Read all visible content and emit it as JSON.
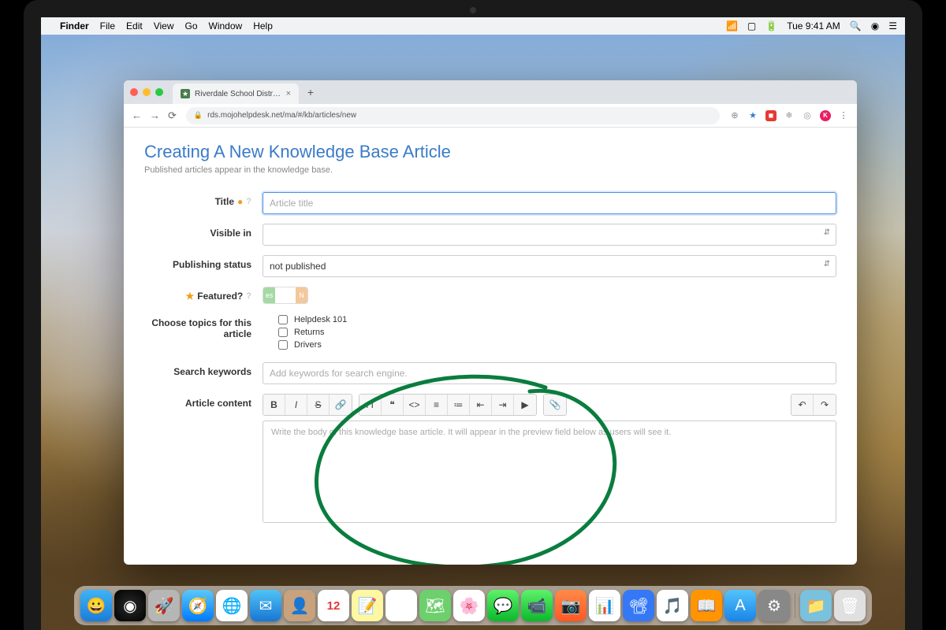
{
  "mac_menu": {
    "app_name": "Finder",
    "items": [
      "File",
      "Edit",
      "View",
      "Go",
      "Window",
      "Help"
    ],
    "clock": "Tue 9:41 AM"
  },
  "browser": {
    "tab_title": "Riverdale School District Crea",
    "url": "rds.mojohelpdesk.net/ma/#/kb/articles/new",
    "avatar_initial": "K"
  },
  "page": {
    "title": "Creating A New Knowledge Base Article",
    "subtitle": "Published articles appear in the knowledge base.",
    "labels": {
      "title": "Title",
      "visible_in": "Visible in",
      "publishing_status": "Publishing status",
      "featured": "Featured?",
      "topics": "Choose topics for this article",
      "keywords": "Search keywords",
      "content": "Article content"
    },
    "title_placeholder": "Article title",
    "publishing_status_value": "not published",
    "toggle": {
      "yes": "es",
      "no": "N"
    },
    "topics": [
      "Helpdesk 101",
      "Returns",
      "Drivers"
    ],
    "keywords_placeholder": "Add keywords for search engine.",
    "editor_placeholder": "Write the body of this knowledge base article. It will appear in the preview field below as users will see it."
  },
  "dock": {
    "apps": [
      {
        "name": "finder",
        "bg": "linear-gradient(#3fb3f7,#1b7dd8)",
        "glyph": "😀"
      },
      {
        "name": "siri",
        "bg": "radial-gradient(circle,#2b2b2b,#000)",
        "glyph": "◉"
      },
      {
        "name": "launchpad",
        "bg": "#b6b6b6",
        "glyph": "🚀"
      },
      {
        "name": "safari",
        "bg": "linear-gradient(#5ac8fa,#007aff)",
        "glyph": "🧭"
      },
      {
        "name": "chrome",
        "bg": "#fff",
        "glyph": "🌐"
      },
      {
        "name": "mail",
        "bg": "linear-gradient(#4fc3f7,#1976d2)",
        "glyph": "✉"
      },
      {
        "name": "contacts",
        "bg": "#c7a27c",
        "glyph": "👤"
      },
      {
        "name": "calendar",
        "bg": "#fff",
        "glyph": "12"
      },
      {
        "name": "notes",
        "bg": "#fff7a1",
        "glyph": "📝"
      },
      {
        "name": "reminders",
        "bg": "#fff",
        "glyph": "☑"
      },
      {
        "name": "maps",
        "bg": "#6dd06d",
        "glyph": "🗺"
      },
      {
        "name": "photos",
        "bg": "#fff",
        "glyph": "🌸"
      },
      {
        "name": "messages",
        "bg": "linear-gradient(#5ef26a,#0bb82b)",
        "glyph": "💬"
      },
      {
        "name": "facetime",
        "bg": "linear-gradient(#5ef26a,#0bb82b)",
        "glyph": "📹"
      },
      {
        "name": "photobooth",
        "bg": "linear-gradient(#ff8a48,#ff5722)",
        "glyph": "📷"
      },
      {
        "name": "numbers",
        "bg": "#fff",
        "glyph": "📊"
      },
      {
        "name": "keynote",
        "bg": "#3478f6",
        "glyph": "📽"
      },
      {
        "name": "itunes",
        "bg": "#fff",
        "glyph": "🎵"
      },
      {
        "name": "ibooks",
        "bg": "#ff9500",
        "glyph": "📖"
      },
      {
        "name": "appstore",
        "bg": "linear-gradient(#52c4fb,#1a84e8)",
        "glyph": "A"
      },
      {
        "name": "preferences",
        "bg": "#888",
        "glyph": "⚙"
      }
    ],
    "right": [
      {
        "name": "downloads",
        "bg": "#7ac1dd",
        "glyph": "📁"
      },
      {
        "name": "trash",
        "bg": "#e0e0e0",
        "glyph": "🗑"
      }
    ]
  }
}
